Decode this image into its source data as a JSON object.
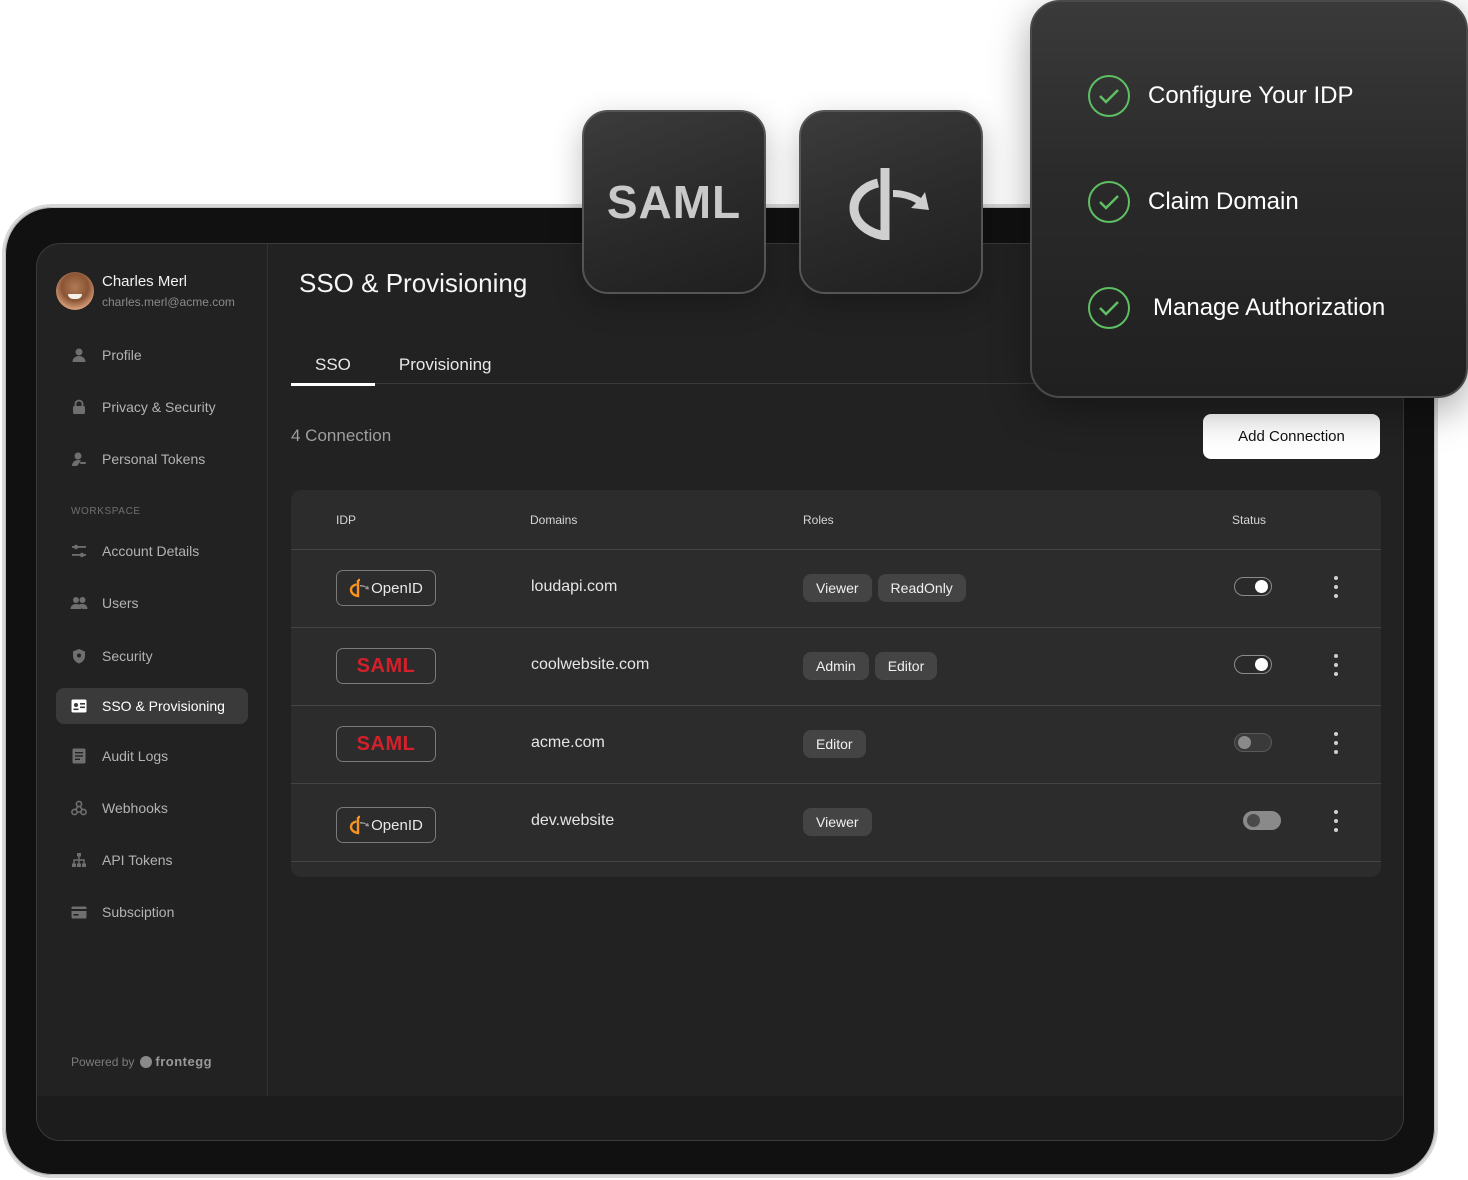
{
  "checklist": {
    "items": [
      {
        "label": "Configure Your IDP"
      },
      {
        "label": "Claim Domain"
      },
      {
        "label": "Manage Authorization"
      }
    ],
    "check_color": "#5fbf63"
  },
  "tiles": {
    "saml_text": "SAML"
  },
  "user": {
    "name": "Charles Merl",
    "email": "charles.merl@acme.com"
  },
  "sidebar": {
    "personal_items": [
      {
        "label": "Profile",
        "icon": "person-icon"
      },
      {
        "label": "Privacy & Security",
        "icon": "lock-icon"
      },
      {
        "label": "Personal Tokens",
        "icon": "person-key-icon"
      }
    ],
    "workspace_section": "WORKSPACE",
    "workspace_items": [
      {
        "label": "Account Details",
        "icon": "sliders-icon"
      },
      {
        "label": "Users",
        "icon": "users-icon"
      },
      {
        "label": "Security",
        "icon": "shield-icon"
      },
      {
        "label": "SSO & Provisioning",
        "icon": "id-card-icon",
        "active": true
      },
      {
        "label": "Audit Logs",
        "icon": "document-icon"
      },
      {
        "label": "Webhooks",
        "icon": "webhook-icon"
      },
      {
        "label": "API Tokens",
        "icon": "hierarchy-icon"
      },
      {
        "label": "Subsciption",
        "icon": "credit-card-icon"
      }
    ],
    "powered_by": "Powered by",
    "brand": "frontegg"
  },
  "main": {
    "title": "SSO & Provisioning",
    "tabs": [
      {
        "label": "SSO",
        "active": true
      },
      {
        "label": "Provisioning",
        "active": false
      }
    ],
    "connection_count": "4 Connection",
    "add_button": "Add Connection"
  },
  "table": {
    "headers": {
      "idp": "IDP",
      "domains": "Domains",
      "roles": "Roles",
      "status": "Status"
    },
    "rows": [
      {
        "idp": "OpenID",
        "domain": "loudapi.com",
        "roles": [
          "Viewer",
          "ReadOnly"
        ],
        "enabled": true
      },
      {
        "idp": "SAML",
        "domain": "coolwebsite.com",
        "roles": [
          "Admin",
          "Editor"
        ],
        "enabled": true
      },
      {
        "idp": "SAML",
        "domain": "acme.com",
        "roles": [
          "Editor"
        ],
        "enabled": false
      },
      {
        "idp": "OpenID",
        "domain": "dev.website",
        "roles": [
          "Viewer"
        ],
        "enabled": false
      }
    ]
  },
  "colors": {
    "saml_red": "#d4202a",
    "openid_orange": "#f7931e",
    "accent_white": "#ffffff"
  }
}
